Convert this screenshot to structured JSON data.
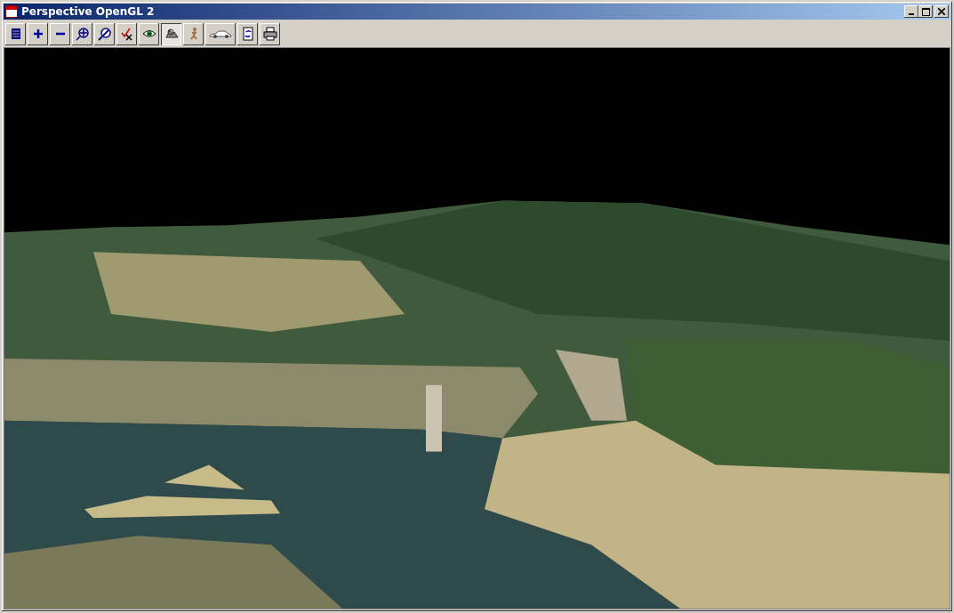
{
  "window": {
    "title": "Perspective OpenGL 2"
  },
  "toolbar": {
    "buttons": [
      {
        "kind": "list",
        "selected": false
      },
      {
        "kind": "plus",
        "selected": false
      },
      {
        "kind": "minus",
        "selected": false
      },
      {
        "kind": "zoom",
        "selected": false
      },
      {
        "kind": "zoom-fit",
        "selected": false
      },
      {
        "kind": "check-cross",
        "selected": false
      },
      {
        "kind": "eye",
        "selected": false
      },
      {
        "kind": "terrain",
        "selected": true
      },
      {
        "kind": "walker",
        "selected": false
      },
      {
        "kind": "car",
        "selected": false
      },
      {
        "kind": "refresh",
        "selected": false
      },
      {
        "kind": "printer",
        "selected": false
      }
    ]
  }
}
